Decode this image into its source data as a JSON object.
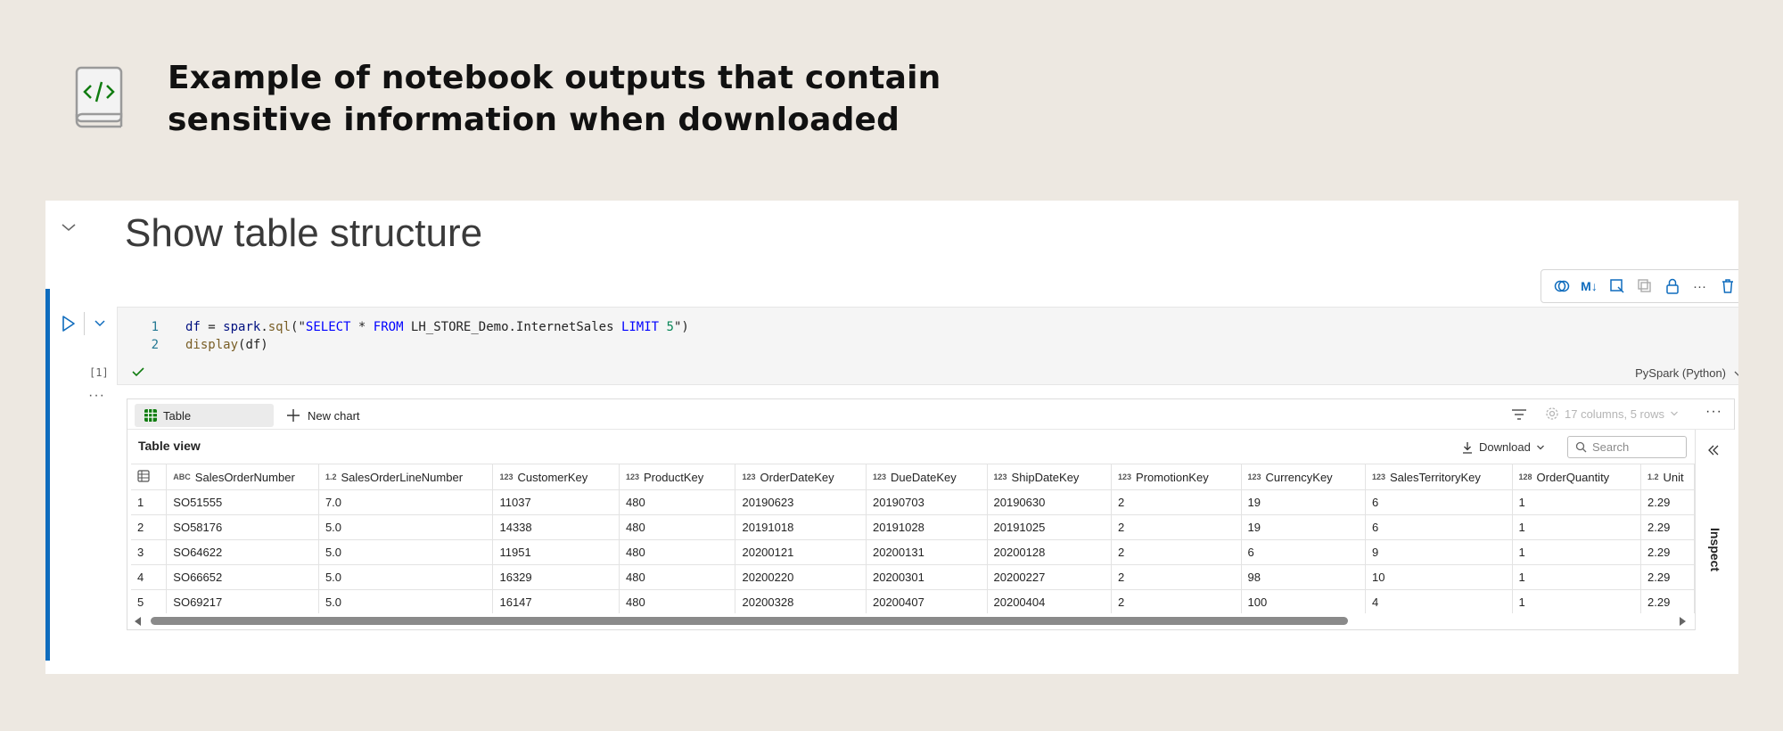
{
  "header": {
    "headline": "Example of notebook outputs that contain sensitive information when downloaded",
    "icon": "code-notebook-icon"
  },
  "markdown": {
    "title": "Show table structure"
  },
  "toolbar": {
    "icons": [
      "copilot-icon",
      "markdown-icon",
      "select-cell-icon",
      "duplicate-icon",
      "lock-icon",
      "more-icon",
      "delete-icon"
    ],
    "markdown_label": "M↓"
  },
  "cell": {
    "exec_count": "[1]",
    "more": "···",
    "language": "PySpark (Python)",
    "code": [
      {
        "n": "1"
      },
      {
        "n": "2"
      }
    ]
  },
  "output": {
    "tab_table": "Table",
    "new_chart": "New chart",
    "columns_rows": "17 columns, 5 rows",
    "table_view": "Table view",
    "download": "Download",
    "search_placeholder": "Search",
    "inspect": "Inspect",
    "more": "···",
    "columns": [
      {
        "type": "ABC",
        "name": "SalesOrderNumber"
      },
      {
        "type": "1.2",
        "name": "SalesOrderLineNumber"
      },
      {
        "type": "123",
        "name": "CustomerKey"
      },
      {
        "type": "123",
        "name": "ProductKey"
      },
      {
        "type": "123",
        "name": "OrderDateKey"
      },
      {
        "type": "123",
        "name": "DueDateKey"
      },
      {
        "type": "123",
        "name": "ShipDateKey"
      },
      {
        "type": "123",
        "name": "PromotionKey"
      },
      {
        "type": "123",
        "name": "CurrencyKey"
      },
      {
        "type": "123",
        "name": "SalesTerritoryKey"
      },
      {
        "type": "128",
        "name": "OrderQuantity"
      },
      {
        "type": "1.2",
        "name": "Unit"
      }
    ],
    "rows": [
      [
        "1",
        "SO51555",
        "7.0",
        "11037",
        "480",
        "20190623",
        "20190703",
        "20190630",
        "2",
        "19",
        "6",
        "1",
        "2.29"
      ],
      [
        "2",
        "SO58176",
        "5.0",
        "14338",
        "480",
        "20191018",
        "20191028",
        "20191025",
        "2",
        "19",
        "6",
        "1",
        "2.29"
      ],
      [
        "3",
        "SO64622",
        "5.0",
        "11951",
        "480",
        "20200121",
        "20200131",
        "20200128",
        "2",
        "6",
        "9",
        "1",
        "2.29"
      ],
      [
        "4",
        "SO66652",
        "5.0",
        "16329",
        "480",
        "20200220",
        "20200301",
        "20200227",
        "2",
        "98",
        "10",
        "1",
        "2.29"
      ],
      [
        "5",
        "SO69217",
        "5.0",
        "16147",
        "480",
        "20200328",
        "20200407",
        "20200404",
        "2",
        "100",
        "4",
        "1",
        "2.29"
      ]
    ]
  },
  "code_tokens": {
    "l1_df": "df",
    "l1_eq": " = ",
    "l1_spark": "spark",
    "l1_dot": ".",
    "l1_sql": "sql",
    "l1_open": "(\"",
    "l1_select": "SELECT",
    "l1_star": " * ",
    "l1_from": "FROM",
    "l1_table": " LH_STORE_Demo.InternetSales ",
    "l1_limit": "LIMIT",
    "l1_sp": " ",
    "l1_five": "5",
    "l1_close": "\")",
    "l2_display": "display",
    "l2_arg": "(df)"
  },
  "colors": {
    "accent": "#0f6cbd",
    "background": "#ede8e1",
    "success": "#107c10"
  }
}
